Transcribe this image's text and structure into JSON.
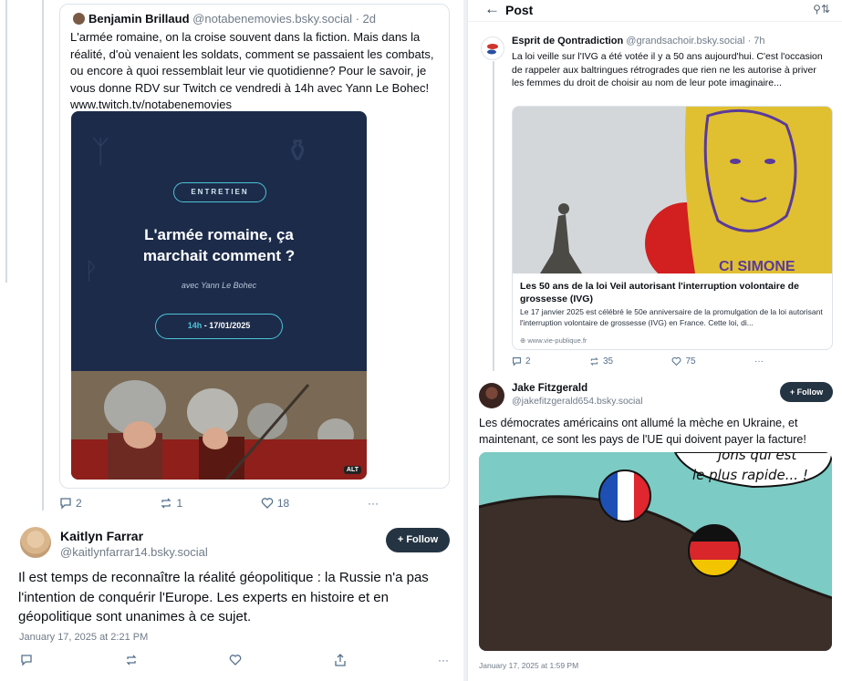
{
  "left": {
    "quoted_post": {
      "author_name": "Benjamin Brillaud",
      "author_handle": "@notabenemovies.bsky.social",
      "age": "· 2d",
      "text": "L'armée romaine, on la croise souvent dans la fiction. Mais dans la réalité, d'où venaient les soldats, comment se passaient les combats, ou encore à quoi ressemblait leur vie quotidienne? Pour le savoir, je vous donne RDV sur Twitch ce vendredi à 14h avec Yann Le Bohec! www.twitch.tv/notabenemovies",
      "image": {
        "badge": "ENTRETIEN",
        "title_line1": "L'armée romaine, ça",
        "title_line2": "marchait comment ?",
        "byline": "avec Yann Le Bohec",
        "date_time": "14h",
        "date_rest": " - 17/01/2025",
        "alt_badge": "ALT"
      },
      "reply_count": "2",
      "repost_count": "1",
      "like_count": "18",
      "more": "···"
    },
    "post": {
      "author_name": "Kaitlyn Farrar",
      "author_handle": "@kaitlynfarrar14.bsky.social",
      "follow_label": "+ Follow",
      "text": "Il est temps de reconnaître la réalité géopolitique : la Russie n'a pas l'intention de conquérir l'Europe. Les experts en histoire et en géopolitique sont unanimes à ce sujet.",
      "date": "January 17, 2025 at 2:21 PM",
      "more": "···"
    }
  },
  "right": {
    "header": {
      "back": "←",
      "title": "Post",
      "settings_icon": "⚲⇅"
    },
    "parent_post": {
      "author_name": "Esprit de Qontradiction",
      "author_handle": "@grandsachoir.bsky.social",
      "age": "· 7h",
      "text": "La loi veille sur l'IVG a été votée il y a 50 ans aujourd'hui. C'est l'occasion de rappeler aux baltringues rétrogrades que rien ne les autorise à priver les femmes du droit de choisir au nom de leur pote imaginaire...",
      "link_card": {
        "banner_text": "CI SIMONE",
        "title": "Les 50 ans de la loi Veil autorisant l'interruption volontaire de grossesse (IVG)",
        "description": "Le 17 janvier 2025 est célébré le 50e anniversaire de la promulgation de la loi autorisant l'interruption volontaire de grossesse (IVG) en France. Cette loi, di...",
        "source": "www.vie-publique.fr"
      },
      "reply_count": "2",
      "repost_count": "35",
      "like_count": "75",
      "more": "···"
    },
    "post": {
      "author_name": "Jake Fitzgerald",
      "author_handle": "@jakefitzgerald654.bsky.social",
      "follow_label": "+ Follow",
      "text": "Les démocrates américains ont allumé la mèche en Ukraine, et maintenant, ce sont les pays de l'UE qui doivent payer la facture!",
      "cartoon_bubble_line1": "jons qui est",
      "cartoon_bubble_line2": "le plus rapide... !",
      "date": "January 17, 2025 at 1:59 PM"
    }
  },
  "colors": {
    "follow_bg": "#253443",
    "link_blue": "#1083fe",
    "muted": "#6f7b88",
    "accent_cyan": "#4cc3d6"
  }
}
